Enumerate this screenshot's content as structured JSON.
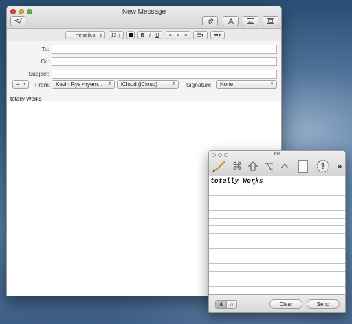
{
  "mail": {
    "title": "New Message",
    "format_bar": {
      "font": "Helvetica",
      "size": "12",
      "bold": "B",
      "italic": "I",
      "underline": "U"
    },
    "headers": {
      "to_label": "To:",
      "to_value": "",
      "cc_label": "Cc:",
      "cc_value": "",
      "subject_label": "Subject:",
      "subject_value": "",
      "from_label": "From:",
      "from_value": "Kevin Rye <ryem...",
      "account_value": "iCloud (iCloud)",
      "signature_label": "Signature:",
      "signature_value": "None"
    },
    "body": "totally Works"
  },
  "ink": {
    "title": "Ink",
    "handwritten_text": "totally Works",
    "more_glyph": "»",
    "clear_label": "Clear",
    "send_label": "Send"
  },
  "colors": {
    "close": "#e2463f",
    "minimize": "#e2a52d",
    "zoom": "#5fb43a",
    "ruled_line": "#b8c6d4"
  },
  "icons": {
    "send": "paper-plane-icon",
    "attach": "paperclip-icon",
    "format": "font-icon",
    "photo": "photo-browser-icon",
    "stationery": "stationery-icon",
    "pen": "pen-icon",
    "command": "command-key-icon",
    "shift": "shift-key-icon",
    "option": "option-key-icon",
    "control": "control-key-icon",
    "pad": "writing-pad-icon",
    "help": "help-icon"
  }
}
